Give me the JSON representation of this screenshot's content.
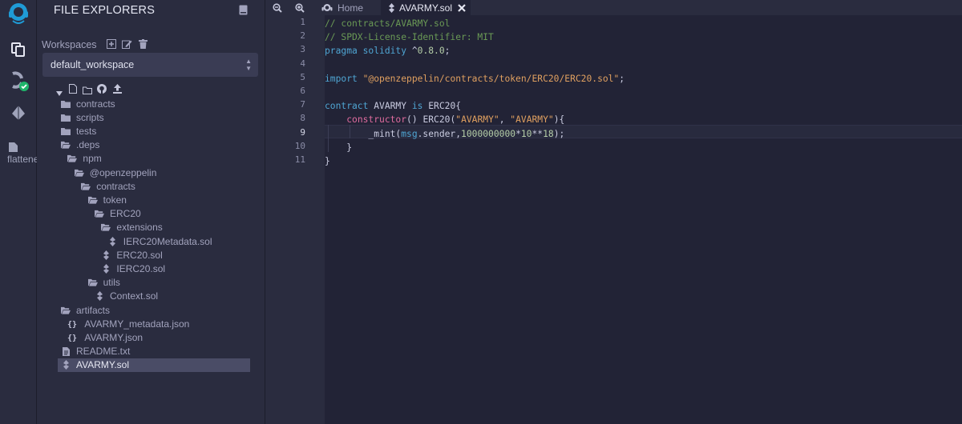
{
  "colors": {
    "accent": "#1f9bd6",
    "success": "#1fb46a",
    "panel": "#2a2c3f",
    "editor": "#222336"
  },
  "rail": {
    "items": [
      {
        "name": "remix-logo-icon"
      },
      {
        "name": "file-explorer-icon"
      },
      {
        "name": "solidity-compiler-icon"
      },
      {
        "name": "deploy-run-icon"
      },
      {
        "name": "flattener-plugin-icon"
      }
    ],
    "plugin_label": "flattene"
  },
  "panel": {
    "title": "FILE EXPLORERS",
    "workspaces_label": "Workspaces",
    "workspace_value": "default_workspace"
  },
  "tree": [
    {
      "label": "contracts",
      "type": "folder",
      "depth": 0
    },
    {
      "label": "scripts",
      "type": "folder",
      "depth": 0
    },
    {
      "label": "tests",
      "type": "folder",
      "depth": 0
    },
    {
      "label": ".deps",
      "type": "folder-open",
      "depth": 0
    },
    {
      "label": "npm",
      "type": "folder-open",
      "depth": 1
    },
    {
      "label": "@openzeppelin",
      "type": "folder-open",
      "depth": 2
    },
    {
      "label": "contracts",
      "type": "folder-open",
      "depth": 3
    },
    {
      "label": "token",
      "type": "folder-open",
      "depth": 4
    },
    {
      "label": "ERC20",
      "type": "folder-open",
      "depth": 5
    },
    {
      "label": "extensions",
      "type": "folder-open",
      "depth": 6
    },
    {
      "label": "IERC20Metadata.sol",
      "type": "sol",
      "depth": 7
    },
    {
      "label": "ERC20.sol",
      "type": "sol",
      "depth": 6
    },
    {
      "label": "IERC20.sol",
      "type": "sol",
      "depth": 6
    },
    {
      "label": "utils",
      "type": "folder-open",
      "depth": 4
    },
    {
      "label": "Context.sol",
      "type": "sol",
      "depth": 5
    },
    {
      "label": "artifacts",
      "type": "folder-open",
      "depth": 0
    },
    {
      "label": "AVARMY_metadata.json",
      "type": "json",
      "depth": 1
    },
    {
      "label": "AVARMY.json",
      "type": "json",
      "depth": 1
    },
    {
      "label": "README.txt",
      "type": "file",
      "depth": 0
    },
    {
      "label": "AVARMY.sol",
      "type": "sol",
      "depth": 0,
      "selected": true
    }
  ],
  "tabs": [
    {
      "label": "Home",
      "icon": "home-icon"
    },
    {
      "label": "AVARMY.sol",
      "icon": "solidity-file-icon",
      "active": true
    }
  ],
  "editor": {
    "active_line": 9,
    "lines": [
      [
        [
          "// contracts/AVARMY.sol",
          "c"
        ]
      ],
      [
        [
          "// SPDX-License-Identifier: MIT",
          "c"
        ]
      ],
      [
        [
          "pragma",
          "k"
        ],
        [
          " "
        ],
        [
          "solidity",
          "k"
        ],
        [
          " ^"
        ],
        [
          "0.8.0",
          "n"
        ],
        [
          ";"
        ]
      ],
      [
        [
          ""
        ]
      ],
      [
        [
          "import",
          "k"
        ],
        [
          " "
        ],
        [
          "\"@openzeppelin/contracts/token/ERC20/ERC20.sol\"",
          "s"
        ],
        [
          ";"
        ]
      ],
      [
        [
          ""
        ]
      ],
      [
        [
          "contract",
          "k"
        ],
        [
          " AVARMY "
        ],
        [
          "is",
          "k"
        ],
        [
          " ERC20{"
        ]
      ],
      [
        [
          "    "
        ],
        [
          "constructor",
          "kp"
        ],
        [
          "() ERC20("
        ],
        [
          "\"AVARMY\"",
          "s"
        ],
        [
          ", "
        ],
        [
          "\"AVARMY\"",
          "s"
        ],
        [
          "){"
        ]
      ],
      [
        [
          "        _mint("
        ],
        [
          "msg",
          "k"
        ],
        [
          ".sender,"
        ],
        [
          "1000000000",
          "n"
        ],
        [
          "*"
        ],
        [
          "10",
          "n"
        ],
        [
          "**"
        ],
        [
          "18",
          "n"
        ],
        [
          ");"
        ]
      ],
      [
        [
          "    }"
        ]
      ],
      [
        [
          "}"
        ]
      ]
    ]
  }
}
